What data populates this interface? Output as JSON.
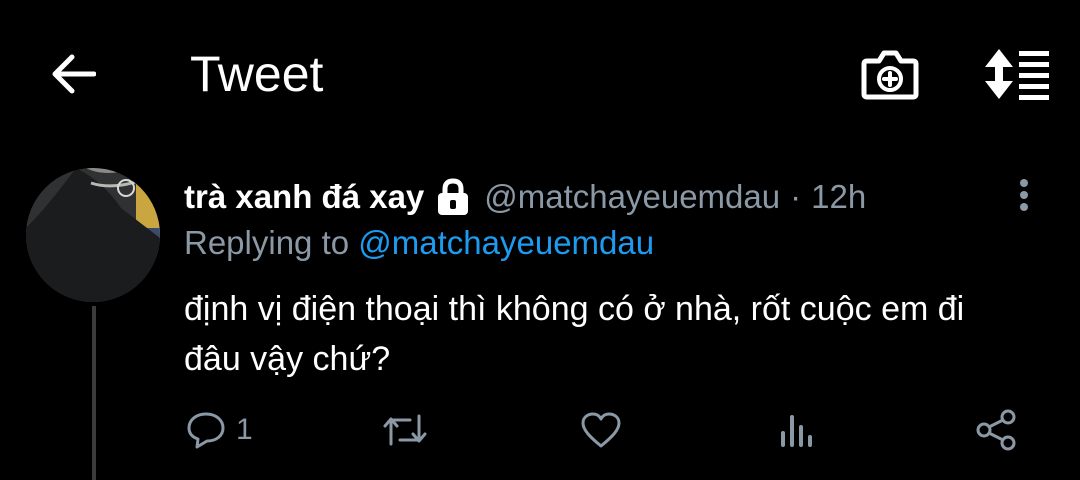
{
  "header": {
    "back_icon": "arrow-left-icon",
    "title": "Tweet",
    "camera_icon": "camera-plus-icon",
    "sort_icon": "sort-lines-icon"
  },
  "tweet": {
    "avatar": "user-avatar",
    "display_name": "trà xanh đá xay",
    "lock_icon": "lock-icon",
    "handle": "@matchayeuemdau",
    "separator": "·",
    "time": "12h",
    "more_icon": "more-vertical-icon",
    "replying_prefix": "Replying to",
    "replying_to": "@matchayeuemdau",
    "text": "định vị điện thoại thì không có ở nhà, rốt cuộc em đi đâu vậy chứ?",
    "actions": {
      "reply_count": "1",
      "reply_icon": "reply-icon",
      "retweet_icon": "retweet-icon",
      "like_icon": "heart-icon",
      "analytics_icon": "analytics-icon",
      "share_icon": "share-icon"
    }
  },
  "colors": {
    "background": "#000000",
    "text_primary": "#ffffff",
    "text_secondary": "#8b98a5",
    "link": "#1d9bf0"
  }
}
